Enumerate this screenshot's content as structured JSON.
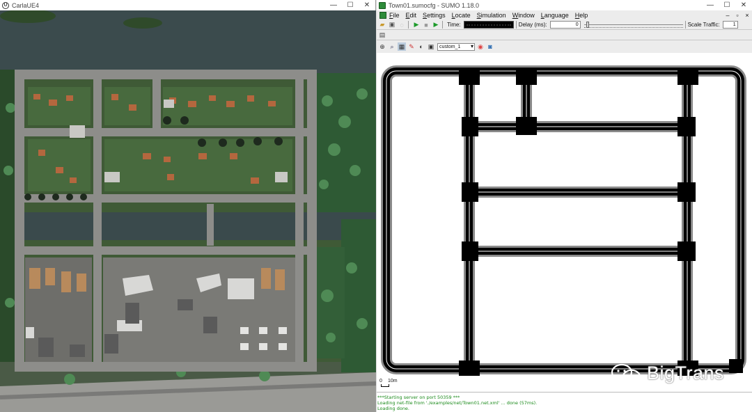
{
  "left_window": {
    "title": "CarlaUE4",
    "icon": "unreal-engine-icon",
    "controls": [
      "—",
      "☐",
      "✕"
    ]
  },
  "right_window": {
    "title": "Town01.sumocfg - SUMO 1.18.0",
    "icon": "sumo-icon",
    "controls": [
      "—",
      "☐",
      "✕"
    ],
    "menu": [
      "File",
      "Edit",
      "Settings",
      "Locate",
      "Simulation",
      "Window",
      "Language",
      "Help"
    ],
    "toolbar": {
      "time_label": "Time:",
      "delay_label": "Delay (ms):",
      "delay_value": "0",
      "scale_label": "Scale Traffic:",
      "scale_value": "1"
    },
    "view": {
      "scheme": "custom_1"
    },
    "scale": {
      "zero": "0",
      "ten": "10m"
    },
    "log": [
      "***Starting server on port 50359 ***",
      "Loading net-file from './examples/net/Town01.net.xml' ... done (57ms).",
      "Loading done."
    ]
  },
  "watermark": "BigTrans",
  "colors": {
    "road": "#000000",
    "road_edge": "#8a8a8a",
    "log_text": "#1a8a1a",
    "grass": "#3f5a36",
    "water": "#3a4a4c",
    "pavement": "#8a8a88"
  }
}
